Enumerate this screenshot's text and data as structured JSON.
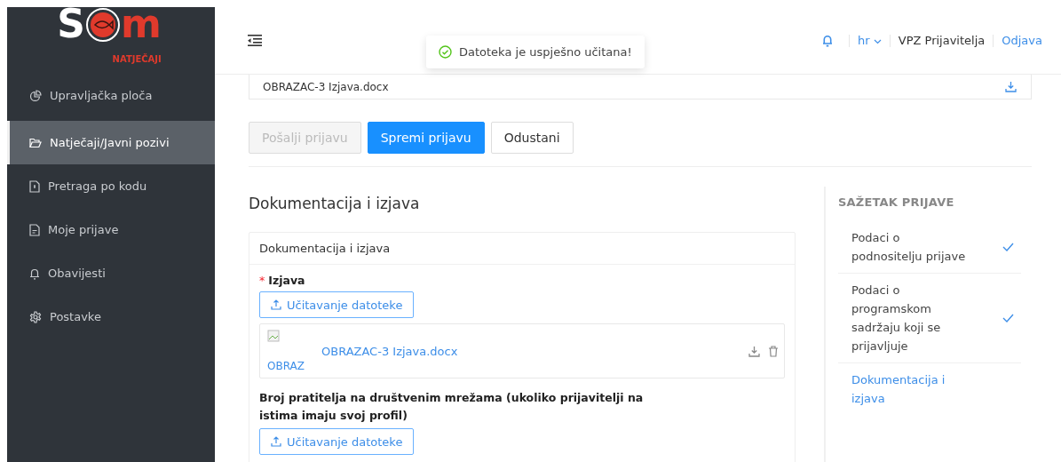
{
  "sidebar": {
    "logo": {
      "left": "S",
      "right": "m",
      "tagline": "NATJEČAJI"
    },
    "items": [
      {
        "label": "Upravljačka ploča",
        "selected": false
      },
      {
        "label": "Natječaji/Javni pozivi",
        "selected": true
      },
      {
        "label": "Pretraga po kodu",
        "selected": false
      },
      {
        "label": "Moje prijave",
        "selected": false
      },
      {
        "label": "Obavijesti",
        "selected": false
      },
      {
        "label": "Postavke",
        "selected": false
      }
    ]
  },
  "header": {
    "language": "hr",
    "user": "VPZ Prijavitelja",
    "logout": "Odjava"
  },
  "toast": {
    "kind": "success",
    "message": "Datoteka je uspješno učitana!"
  },
  "top_file": {
    "name": "OBRAZAC-3 Izjava.docx"
  },
  "actions": [
    {
      "label": "Pošalji prijavu",
      "kind": "default",
      "disabled": true
    },
    {
      "label": "Spremi prijavu",
      "kind": "primary",
      "disabled": false
    },
    {
      "label": "Odustani",
      "kind": "default",
      "disabled": false
    }
  ],
  "section_title": "Dokumentacija i izjava",
  "card": {
    "title": "Dokumentacija i izjava",
    "fields": [
      {
        "label": "Izjava",
        "required_mark": "*",
        "upload_label": "Učitavanje datoteke",
        "files": [
          {
            "name": "OBRAZAC-3 Izjava.docx",
            "thumbnail_alt": "OBRAZ"
          }
        ]
      },
      {
        "label": "Broj pratitelja na društvenim mrežama (ukoliko prijavitelji na istima imaju svoj profil)",
        "upload_label": "Učitavanje datoteke"
      }
    ]
  },
  "summary": {
    "title": "SAŽETAK PRIJAVE",
    "steps": [
      {
        "label": "Podaci o podnositelju prijave",
        "done": true,
        "selected": false
      },
      {
        "label": "Podaci o programskom sadržaju koji se prijavljuje",
        "done": true,
        "selected": false
      },
      {
        "label": "Dokumentacija i izjava",
        "done": false,
        "selected": true
      }
    ]
  }
}
